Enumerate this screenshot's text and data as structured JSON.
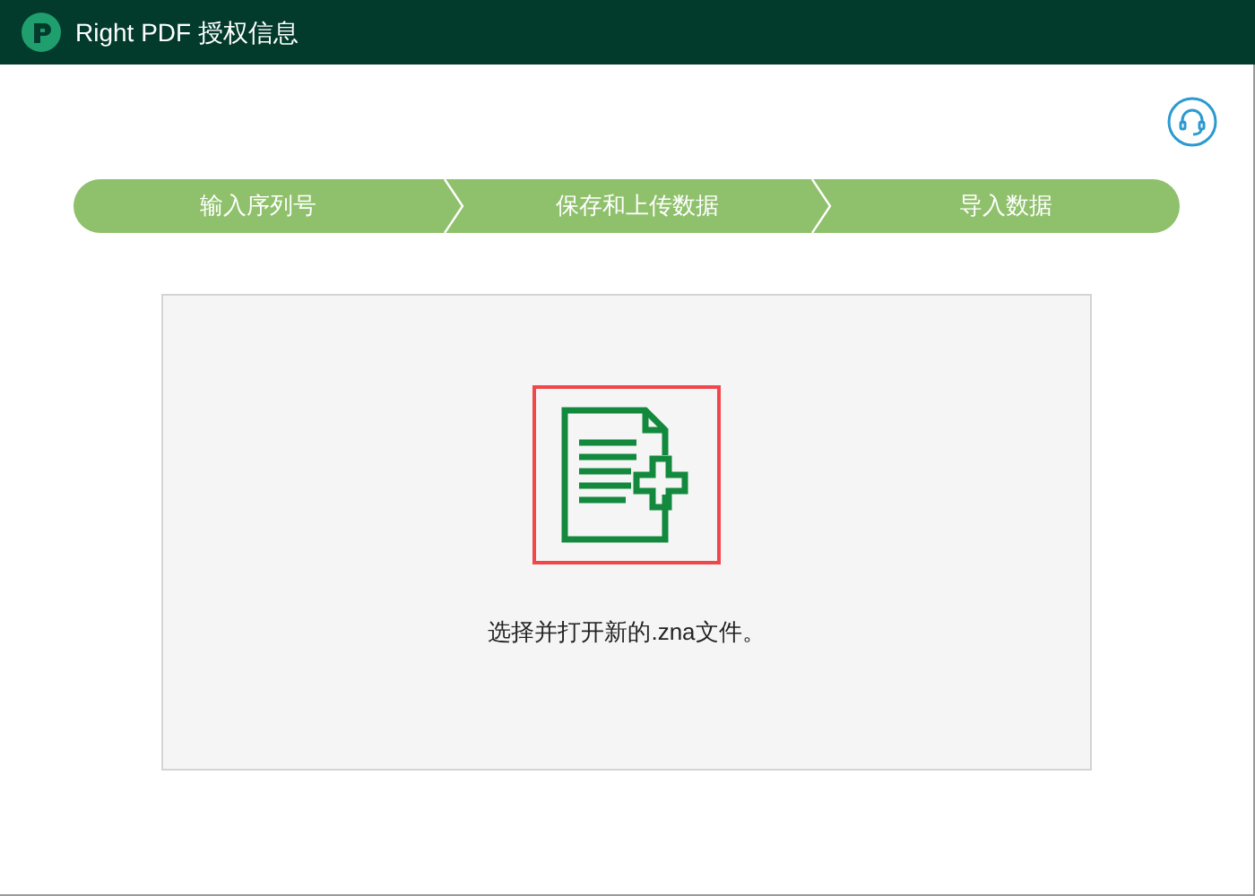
{
  "window": {
    "title": "Right PDF 授权信息"
  },
  "steps": [
    {
      "label": "输入序列号",
      "done": true
    },
    {
      "label": "保存和上传数据",
      "done": true
    },
    {
      "label": "导入数据",
      "done": true
    }
  ],
  "dropzone": {
    "text": "选择并打开新的.zna文件。"
  }
}
